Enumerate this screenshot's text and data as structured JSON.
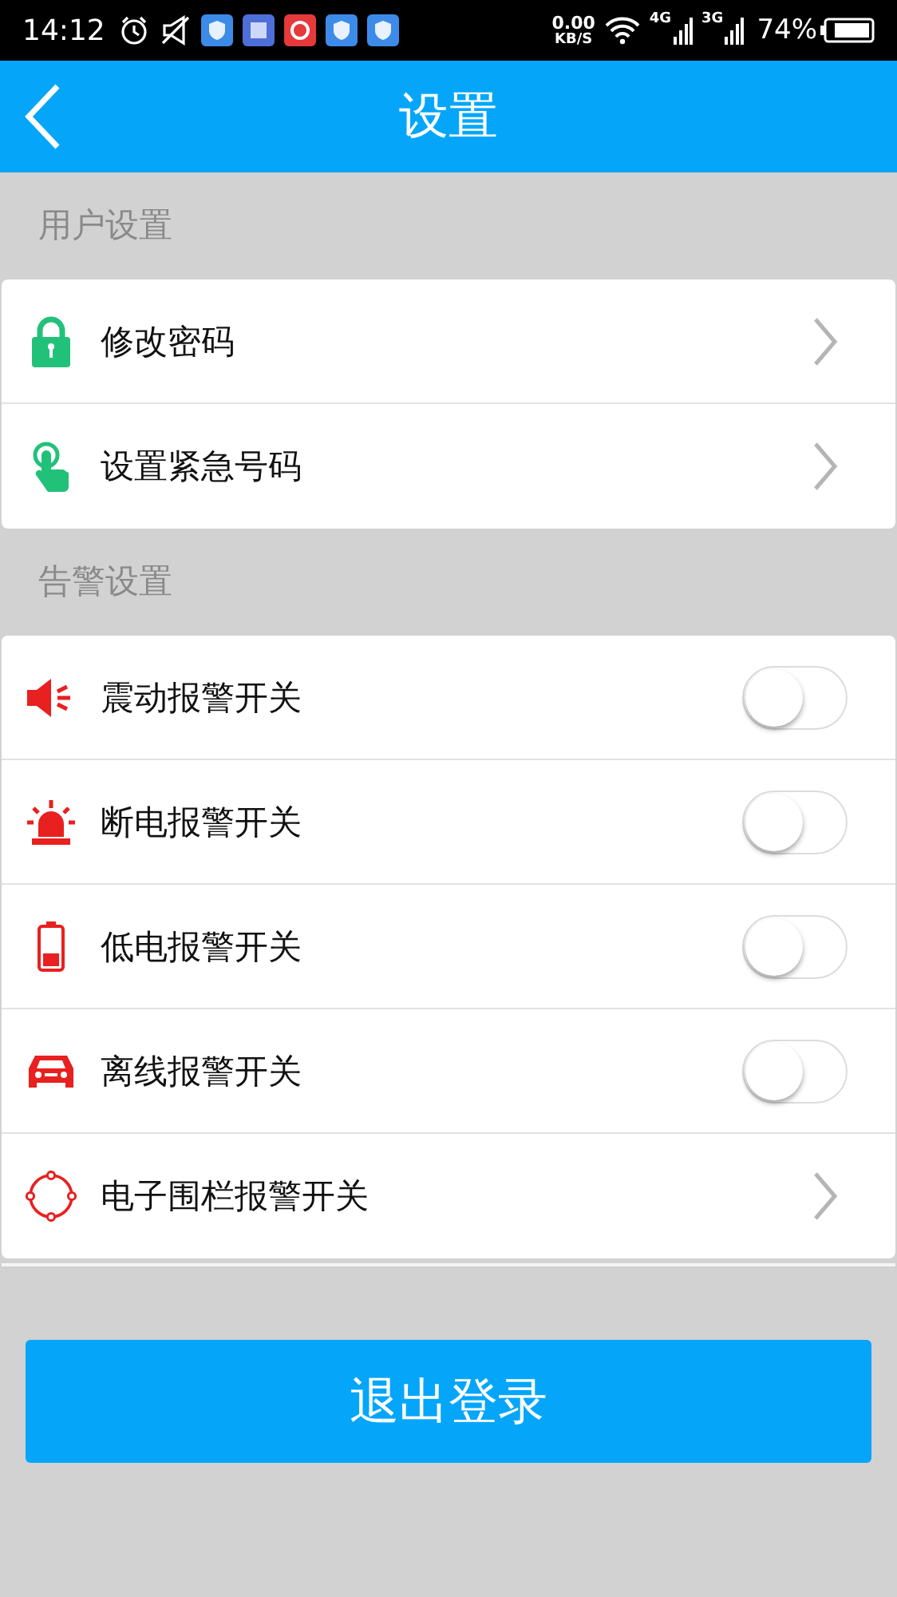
{
  "status_bar": {
    "time": "14:12",
    "speed": "0.00",
    "speed_unit": "KB/S",
    "net_1": "4G",
    "net_2": "3G",
    "battery": "74%"
  },
  "header": {
    "title": "设置"
  },
  "sections": [
    {
      "title": "用户设置",
      "items": [
        {
          "label": "修改密码",
          "kind": "link"
        },
        {
          "label": "设置紧急号码",
          "kind": "link"
        }
      ]
    },
    {
      "title": "告警设置",
      "items": [
        {
          "label": "震动报警开关",
          "kind": "switch",
          "on": false
        },
        {
          "label": "断电报警开关",
          "kind": "switch",
          "on": false
        },
        {
          "label": "低电报警开关",
          "kind": "switch",
          "on": false
        },
        {
          "label": "离线报警开关",
          "kind": "switch",
          "on": false
        },
        {
          "label": "电子围栏报警开关",
          "kind": "link"
        }
      ]
    }
  ],
  "logout_button": "退出登录"
}
